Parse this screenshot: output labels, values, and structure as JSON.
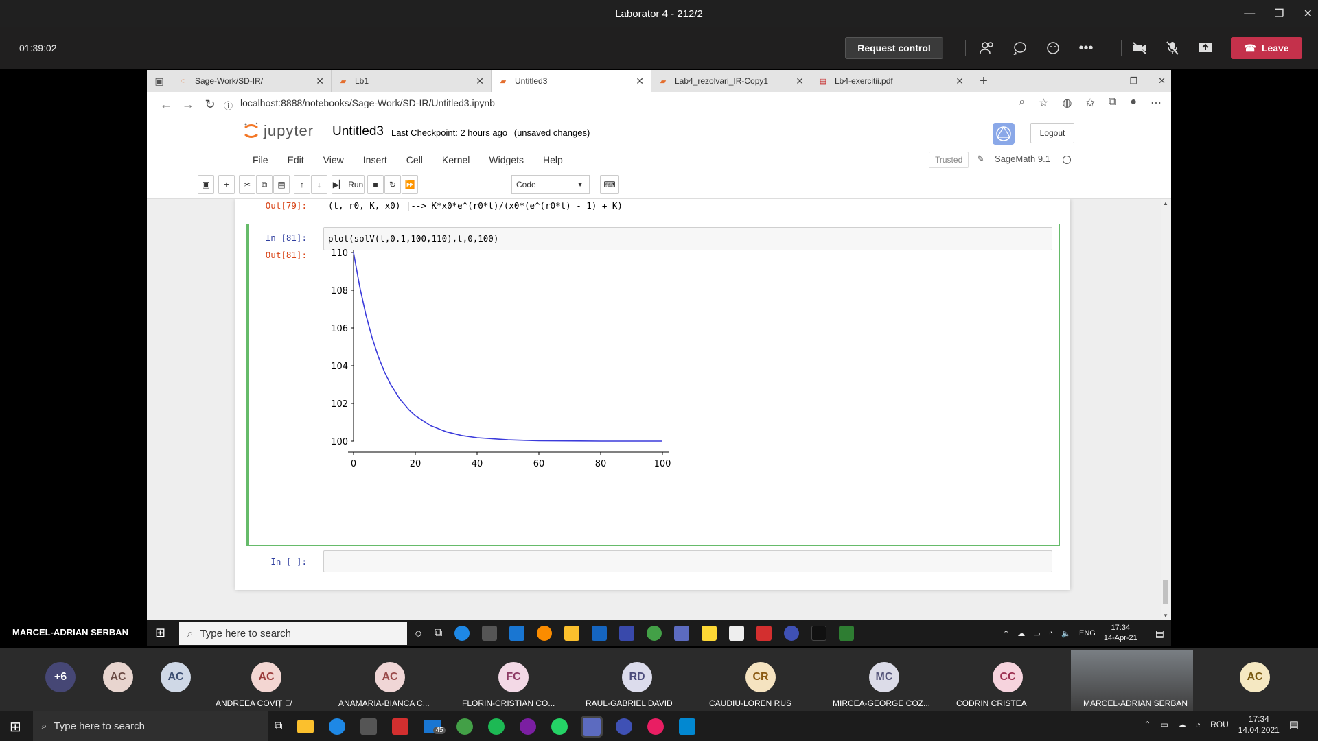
{
  "teams": {
    "window_title": "Laborator 4 - 212/2",
    "timer": "01:39:02",
    "request_control": "Request control",
    "leave": "Leave",
    "presenter": "MARCEL-ADRIAN SERBAN"
  },
  "browser": {
    "tabs": [
      {
        "label": "Sage-Work/SD-IR/",
        "icon": "jupyter-icon"
      },
      {
        "label": "Lb1",
        "icon": "jupyter-icon"
      },
      {
        "label": "Untitled3",
        "icon": "jupyter-icon",
        "active": true
      },
      {
        "label": "Lab4_rezolvari_IR-Copy1",
        "icon": "jupyter-icon"
      },
      {
        "label": "Lb4-exercitii.pdf",
        "icon": "pdf-icon"
      }
    ],
    "url": "localhost:8888/notebooks/Sage-Work/SD-IR/Untitled3.ipynb"
  },
  "jupyter": {
    "logo_text": "jupyter",
    "notebook_name": "Untitled3",
    "checkpoint": "Last Checkpoint: 2 hours ago",
    "unsaved": "(unsaved changes)",
    "logout": "Logout",
    "menu": [
      "File",
      "Edit",
      "View",
      "Insert",
      "Cell",
      "Kernel",
      "Widgets",
      "Help"
    ],
    "trusted": "Trusted",
    "kernel": "SageMath 9.1",
    "run_label": "Run",
    "cell_type": "Code"
  },
  "cells": {
    "prev_out_prompt": "Out[79]:",
    "prev_out_text": "(t, r0, K, x0) |--> K*x0*e^(r0*t)/(x0*(e^(r0*t) - 1) + K)",
    "in_prompt": "In [81]:",
    "code": "plot(solV(t,0.1,100,110),t,0,100)",
    "out_prompt": "Out[81]:",
    "empty_prompt": "In [ ]:"
  },
  "chart_data": {
    "type": "line",
    "title": "",
    "xlabel": "",
    "ylabel": "",
    "xlim": [
      0,
      100
    ],
    "ylim": [
      100,
      110
    ],
    "xticks": [
      "0",
      "20",
      "40",
      "60",
      "80",
      "100"
    ],
    "yticks": [
      "100",
      "102",
      "104",
      "106",
      "108",
      "110"
    ],
    "series": [
      {
        "color": "#3b3bdb",
        "x": [
          0,
          2,
          4,
          6,
          8,
          10,
          12,
          15,
          18,
          20,
          25,
          30,
          35,
          40,
          50,
          60,
          70,
          80,
          90,
          100
        ],
        "y": [
          110,
          108.19,
          106.7,
          105.49,
          104.49,
          103.68,
          103.01,
          102.23,
          101.65,
          101.35,
          100.82,
          100.5,
          100.3,
          100.18,
          100.07,
          100.02,
          100.01,
          100.0,
          100.0,
          100.0
        ]
      }
    ],
    "grid": false
  },
  "share_taskbar": {
    "search_placeholder": "Type here to search",
    "lang": "ENG",
    "time": "17:34",
    "date": "14-Apr-21"
  },
  "participants": {
    "overflow": "+6",
    "list": [
      {
        "initials": "AC",
        "name": ""
      },
      {
        "initials": "AC",
        "name": ""
      },
      {
        "initials": "AC",
        "name": "ANDREEA COVIȚ"
      },
      {
        "initials": "AC",
        "name": "ANAMARIA-BIANCA C..."
      },
      {
        "initials": "FC",
        "name": "FLORIN-CRISTIAN CO..."
      },
      {
        "initials": "RD",
        "name": "RAUL-GABRIEL DAVID"
      },
      {
        "initials": "CR",
        "name": "CAUDIU-LOREN RUS"
      },
      {
        "initials": "MC",
        "name": "MIRCEA-GEORGE COZ..."
      },
      {
        "initials": "CC",
        "name": "CODRIN CRISTEA"
      }
    ],
    "self_name": "MARCEL-ADRIAN SERBAN",
    "self_initials": "AC"
  },
  "host_taskbar": {
    "search_placeholder": "Type here to search",
    "lang": "ROU",
    "time": "17:34",
    "date": "14.04.2021",
    "mail_badge": "45"
  }
}
